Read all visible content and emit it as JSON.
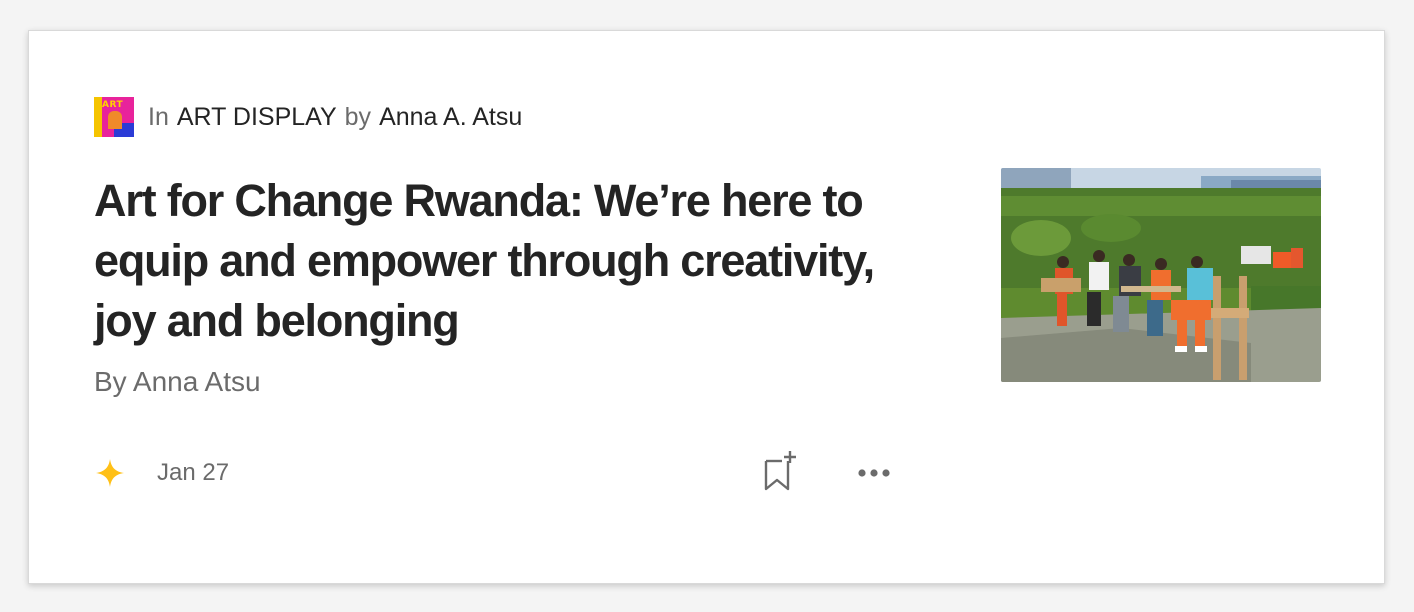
{
  "publication": {
    "avatar_text": "ART",
    "in_label": "In",
    "name": "ART DISPLAY",
    "by_label": "by",
    "author": "Anna A. Atsu"
  },
  "article": {
    "title": "Art for Change Rwanda: We’re here to equip and empower through creativity, joy and belonging",
    "subtitle": "By Anna Atsu",
    "date": "Jan 27",
    "member_only_icon": "sparkle-star-icon",
    "thumbnail_alt": "Students sitting on wooden chairs drawing outdoors in a garden"
  },
  "actions": {
    "bookmark_icon": "bookmark-add-icon",
    "more_icon": "more-horizontal-icon"
  },
  "colors": {
    "text_primary": "#242424",
    "text_muted": "#6b6b6b",
    "star": "#ffc017",
    "card_background": "#ffffff"
  }
}
